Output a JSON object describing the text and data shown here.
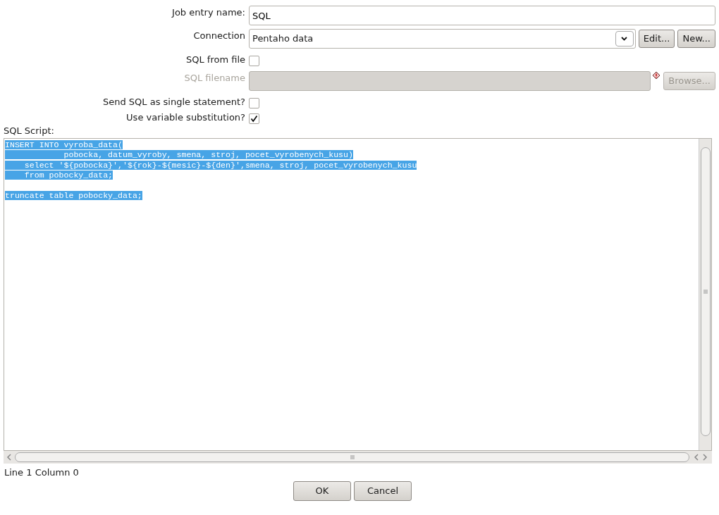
{
  "job_entry_name": {
    "label": "Job entry name:",
    "value": "SQL"
  },
  "connection": {
    "label": "Connection",
    "value": "Pentaho data",
    "buttons": [
      {
        "label": "Edit..."
      },
      {
        "label": "New..."
      }
    ]
  },
  "sql_from_file": {
    "label": "SQL from file",
    "checked": false
  },
  "sql_filename": {
    "label": "SQL filename",
    "disabled": true,
    "button": {
      "label": "Browse..."
    }
  },
  "send_single_statement": {
    "label": "Send SQL as single statement?",
    "checked": false
  },
  "use_variable_substitution": {
    "label": "Use variable substitution?",
    "checked": true
  },
  "sql_script": {
    "label": "SQL Script:",
    "selected": true,
    "text": "INSERT INTO vyroba_data(\n            pobocka, datum_vyroby, smena, stroj, pocet_vyrobenych_kusu)\n    select '${pobocka}','${rok}-${mesic}-${den}',smena, stroj, pocet_vyrobenych_kusu\n    from pobocky_data;\n\ntruncate table pobocky_data;"
  },
  "status": "Line 1 Column 0",
  "buttons": [
    {
      "label": "OK"
    },
    {
      "label": "Cancel"
    }
  ]
}
